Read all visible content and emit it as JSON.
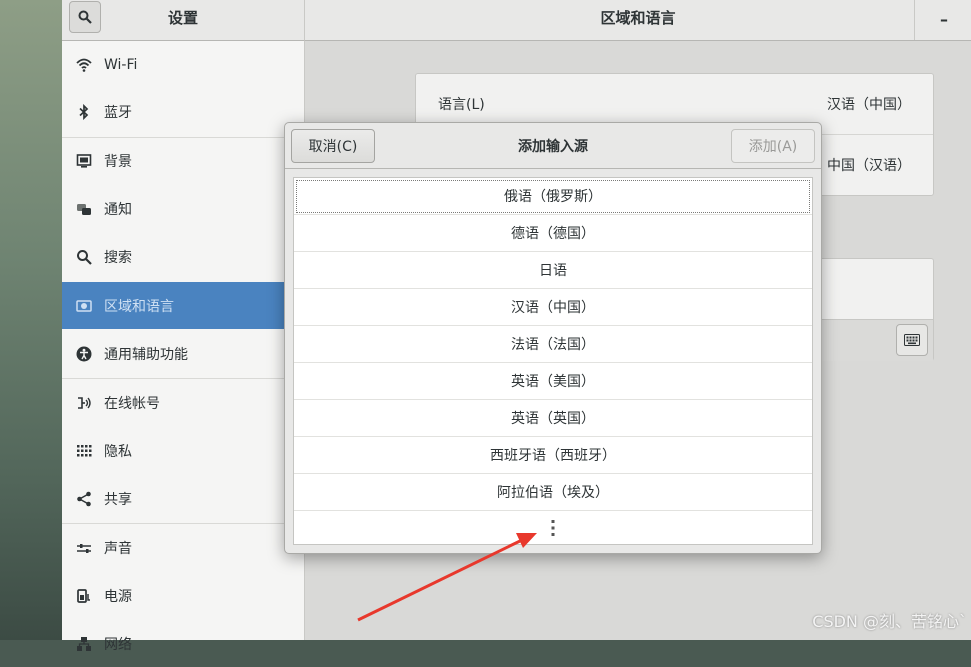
{
  "settings": {
    "title": "设置",
    "panel_title": "区域和语言",
    "minimize": "–"
  },
  "sidebar": {
    "items": [
      {
        "label": "Wi-Fi",
        "icon": "wifi-icon"
      },
      {
        "label": "蓝牙",
        "icon": "bluetooth-icon"
      },
      {
        "label": "背景",
        "icon": "background-icon"
      },
      {
        "label": "通知",
        "icon": "notification-icon"
      },
      {
        "label": "搜索",
        "icon": "search-icon"
      },
      {
        "label": "区域和语言",
        "icon": "region-icon"
      },
      {
        "label": "通用辅助功能",
        "icon": "accessibility-icon"
      },
      {
        "label": "在线帐号",
        "icon": "online-accounts-icon"
      },
      {
        "label": "隐私",
        "icon": "privacy-icon"
      },
      {
        "label": "共享",
        "icon": "share-icon"
      },
      {
        "label": "声音",
        "icon": "sound-icon"
      },
      {
        "label": "电源",
        "icon": "power-icon"
      },
      {
        "label": "网络",
        "icon": "network-icon"
      }
    ]
  },
  "region": {
    "language_label": "语言(L)",
    "language_value": "汉语（中国）",
    "formats_value": "中国（汉语）"
  },
  "dialog": {
    "cancel": "取消(C)",
    "title": "添加输入源",
    "add": "添加(A)",
    "languages": [
      "俄语（俄罗斯）",
      "德语（德国）",
      "日语",
      "汉语（中国）",
      "法语（法国）",
      "英语（美国）",
      "英语（英国）",
      "西班牙语（西班牙）",
      "阿拉伯语（埃及）"
    ],
    "more_icon": "more-vertical-icon"
  },
  "watermark": "CSDN @刻、苦铭心`",
  "colors": {
    "accent": "#4a83c0",
    "annotation_arrow": "#e8382c"
  }
}
